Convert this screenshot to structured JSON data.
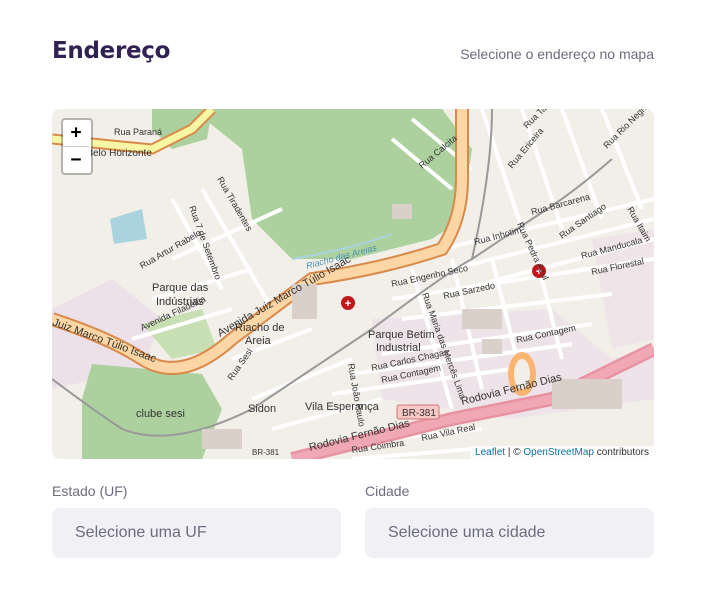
{
  "header": {
    "title": "Endereço",
    "hint": "Selecione o endereço no mapa"
  },
  "map": {
    "zoom_in": "+",
    "zoom_out": "−",
    "attribution": {
      "leaflet": "Leaflet",
      "separator": " | © ",
      "osm": "OpenStreetMap",
      "suffix": " contributors"
    },
    "labels": {
      "belo_horizonte": "Av. Belo Horizonte",
      "rua_parana": "Rua Paraná",
      "parque_industrias": "Parque das",
      "parque_industrias2": "Indústrias",
      "riacho": "Riacho de",
      "riacho2": "Areia",
      "parque_betim": "Parque Betim",
      "parque_betim2": "Industrial",
      "clube": "clube sesi",
      "sidon": "Sidon",
      "vila": "Vila Esperança",
      "br381": "BR-381",
      "br381b": "BR-381",
      "rodovia1": "Rodovia Fernão Dias",
      "rodovia2": "Rodovia Fernão Dias",
      "avenida1": "Avenida Juiz Marco Túlio Isaac",
      "avenida2": "Juiz Marco Túlio Isaac",
      "riacho_areias": "Riacho das Areias",
      "rua_inhotim": "Rua Inhotim",
      "rua_engenho": "Rua Engenho Seco",
      "rua_sarzedo": "Rua Sarzedo",
      "rua_contagem": "Rua Contagem",
      "rua_contagem2": "Rua Contagem",
      "rua_carlos": "Rua Carlos Chagas",
      "rua_coimbra": "Rua Coimbra",
      "rua_vila_real": "Rua Vila Real",
      "rua_florestal": "Rua Florestal",
      "rua_barcarena": "Rua Barcarena",
      "av_filadelfia": "Avenida Filadélfia",
      "rua_artur": "Rua Artur Rabelo",
      "rua_calcita": "Rua Calcita",
      "rua_ericeira": "Rua Ericeira",
      "rua_pedra_azul": "Rua Pedra Azul",
      "rua_maria": "Rua Maria das Mercês Lima",
      "rua_joao_paulo": "Rua João Paulo",
      "rua_manducala": "Rua Manducala",
      "rua_santiago": "Rua Santiago",
      "rua_sesi": "Rua Sesi",
      "rua_tiradentes": "Rua Tiradentes",
      "rua_7_set": "Rua 7 de Setembro",
      "rua_itaim": "Rua Itaim",
      "rua_rio_negro": "Rua Rio Negro",
      "rua_taboa": "Rua Tavora"
    },
    "colors": {
      "land": "#f2efe9",
      "park": "#add19e",
      "trunk": "#f9b571",
      "motorway": "#e892a2",
      "residential": "#ffffff",
      "industrial": "#ebdbe8",
      "water": "#aad3df",
      "hospital": "#c0171d"
    }
  },
  "form": {
    "estado_label": "Estado (UF)",
    "estado_placeholder": "Selecione uma UF",
    "cidade_label": "Cidade",
    "cidade_placeholder": "Selecione uma cidade"
  }
}
